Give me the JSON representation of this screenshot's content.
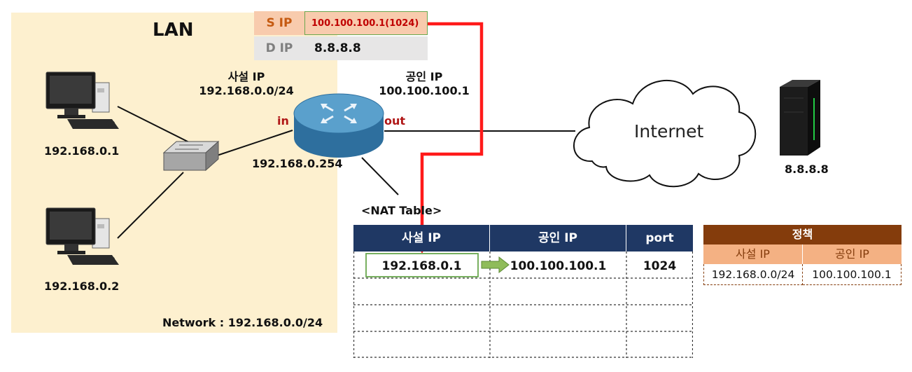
{
  "lan": {
    "title": "LAN",
    "network_label": "Network : 192.168.0.0/24"
  },
  "private_ip": {
    "title": "사설 IP",
    "range": "192.168.0.0/24"
  },
  "public_ip": {
    "title": "공인 IP",
    "value": "100.100.100.1"
  },
  "router": {
    "in_label": "in",
    "out_label": "out",
    "ip": "192.168.0.254"
  },
  "hosts": [
    {
      "ip": "192.168.0.1"
    },
    {
      "ip": "192.168.0.2"
    }
  ],
  "internet": {
    "label": "Internet"
  },
  "server": {
    "ip": "8.8.8.8"
  },
  "packet": {
    "source": {
      "key": "S IP",
      "value": "100.100.100.1(1024)"
    },
    "destination": {
      "key": "D IP",
      "value": "8.8.8.8"
    }
  },
  "nat_table": {
    "title": "<NAT Table>",
    "columns": [
      "사설 IP",
      "공인 IP",
      "port"
    ],
    "rows": [
      {
        "private": "192.168.0.1",
        "public": "100.100.100.1",
        "port": "1024"
      }
    ]
  },
  "policy": {
    "title": "정책",
    "columns": [
      "사설 IP",
      "공인 IP"
    ],
    "row": {
      "private": "192.168.0.0/24",
      "public": "100.100.100.1"
    }
  },
  "colors": {
    "lan_background": "#fdf0cf",
    "accent_red": "#c00000",
    "nat_header": "#1f3864",
    "policy_header": "#843c0c",
    "policy_subheader": "#f4b183",
    "arrow_green": "#8fbc5a"
  }
}
